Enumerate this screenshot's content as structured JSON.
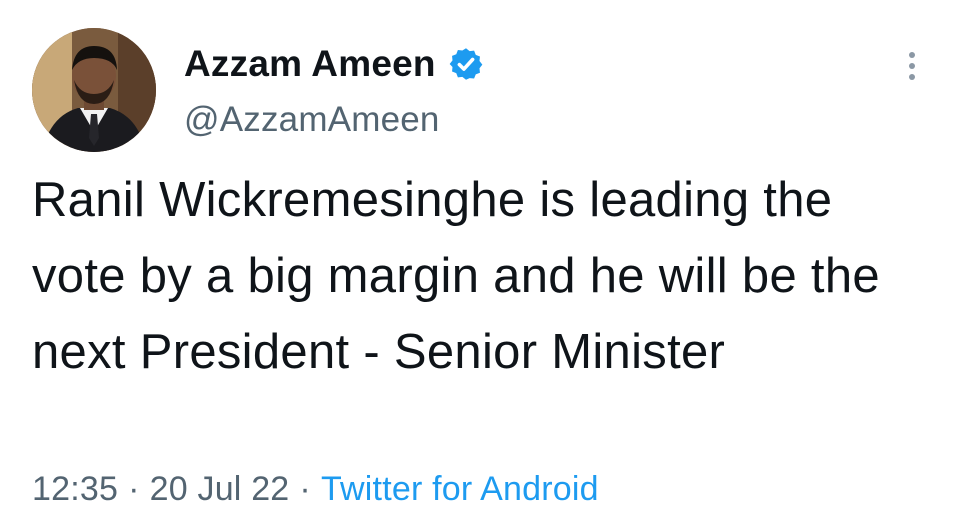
{
  "author": {
    "display_name": "Azzam Ameen",
    "handle": "@AzzamAmeen",
    "verified": true,
    "avatar_icon": "profile-photo",
    "verified_icon": "verified-badge-icon",
    "verified_color": "#1d9bf0"
  },
  "tweet": {
    "text": "Ranil Wickremesinghe is leading the vote by a big margin and he will be the next President - Senior Minister",
    "time": "12:35",
    "date": "20 Jul 22",
    "separator": "·",
    "source": "Twitter for Android"
  },
  "menu": {
    "icon": "more-vertical-icon"
  },
  "colors": {
    "text": "#0f1419",
    "secondary": "#536471",
    "accent": "#1d9bf0",
    "background": "#ffffff"
  }
}
